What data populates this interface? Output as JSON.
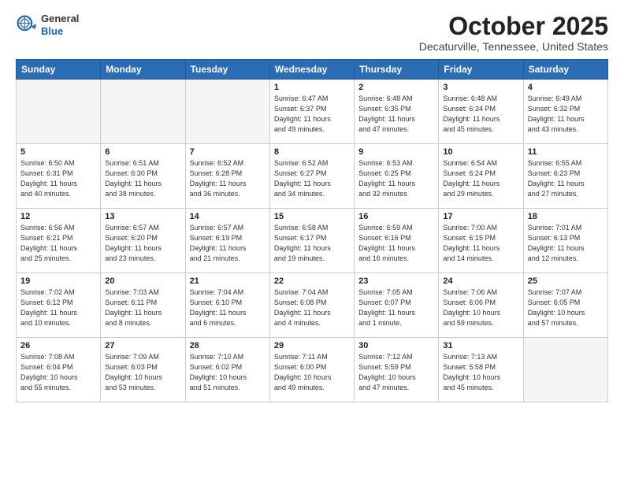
{
  "header": {
    "logo_line1": "General",
    "logo_line2": "Blue",
    "month": "October 2025",
    "location": "Decaturville, Tennessee, United States"
  },
  "weekdays": [
    "Sunday",
    "Monday",
    "Tuesday",
    "Wednesday",
    "Thursday",
    "Friday",
    "Saturday"
  ],
  "weeks": [
    [
      {
        "day": "",
        "info": ""
      },
      {
        "day": "",
        "info": ""
      },
      {
        "day": "",
        "info": ""
      },
      {
        "day": "1",
        "info": "Sunrise: 6:47 AM\nSunset: 6:37 PM\nDaylight: 11 hours\nand 49 minutes."
      },
      {
        "day": "2",
        "info": "Sunrise: 6:48 AM\nSunset: 6:35 PM\nDaylight: 11 hours\nand 47 minutes."
      },
      {
        "day": "3",
        "info": "Sunrise: 6:48 AM\nSunset: 6:34 PM\nDaylight: 11 hours\nand 45 minutes."
      },
      {
        "day": "4",
        "info": "Sunrise: 6:49 AM\nSunset: 6:32 PM\nDaylight: 11 hours\nand 43 minutes."
      }
    ],
    [
      {
        "day": "5",
        "info": "Sunrise: 6:50 AM\nSunset: 6:31 PM\nDaylight: 11 hours\nand 40 minutes."
      },
      {
        "day": "6",
        "info": "Sunrise: 6:51 AM\nSunset: 6:30 PM\nDaylight: 11 hours\nand 38 minutes."
      },
      {
        "day": "7",
        "info": "Sunrise: 6:52 AM\nSunset: 6:28 PM\nDaylight: 11 hours\nand 36 minutes."
      },
      {
        "day": "8",
        "info": "Sunrise: 6:52 AM\nSunset: 6:27 PM\nDaylight: 11 hours\nand 34 minutes."
      },
      {
        "day": "9",
        "info": "Sunrise: 6:53 AM\nSunset: 6:25 PM\nDaylight: 11 hours\nand 32 minutes."
      },
      {
        "day": "10",
        "info": "Sunrise: 6:54 AM\nSunset: 6:24 PM\nDaylight: 11 hours\nand 29 minutes."
      },
      {
        "day": "11",
        "info": "Sunrise: 6:55 AM\nSunset: 6:23 PM\nDaylight: 11 hours\nand 27 minutes."
      }
    ],
    [
      {
        "day": "12",
        "info": "Sunrise: 6:56 AM\nSunset: 6:21 PM\nDaylight: 11 hours\nand 25 minutes."
      },
      {
        "day": "13",
        "info": "Sunrise: 6:57 AM\nSunset: 6:20 PM\nDaylight: 11 hours\nand 23 minutes."
      },
      {
        "day": "14",
        "info": "Sunrise: 6:57 AM\nSunset: 6:19 PM\nDaylight: 11 hours\nand 21 minutes."
      },
      {
        "day": "15",
        "info": "Sunrise: 6:58 AM\nSunset: 6:17 PM\nDaylight: 11 hours\nand 19 minutes."
      },
      {
        "day": "16",
        "info": "Sunrise: 6:59 AM\nSunset: 6:16 PM\nDaylight: 11 hours\nand 16 minutes."
      },
      {
        "day": "17",
        "info": "Sunrise: 7:00 AM\nSunset: 6:15 PM\nDaylight: 11 hours\nand 14 minutes."
      },
      {
        "day": "18",
        "info": "Sunrise: 7:01 AM\nSunset: 6:13 PM\nDaylight: 11 hours\nand 12 minutes."
      }
    ],
    [
      {
        "day": "19",
        "info": "Sunrise: 7:02 AM\nSunset: 6:12 PM\nDaylight: 11 hours\nand 10 minutes."
      },
      {
        "day": "20",
        "info": "Sunrise: 7:03 AM\nSunset: 6:11 PM\nDaylight: 11 hours\nand 8 minutes."
      },
      {
        "day": "21",
        "info": "Sunrise: 7:04 AM\nSunset: 6:10 PM\nDaylight: 11 hours\nand 6 minutes."
      },
      {
        "day": "22",
        "info": "Sunrise: 7:04 AM\nSunset: 6:08 PM\nDaylight: 11 hours\nand 4 minutes."
      },
      {
        "day": "23",
        "info": "Sunrise: 7:05 AM\nSunset: 6:07 PM\nDaylight: 11 hours\nand 1 minute."
      },
      {
        "day": "24",
        "info": "Sunrise: 7:06 AM\nSunset: 6:06 PM\nDaylight: 10 hours\nand 59 minutes."
      },
      {
        "day": "25",
        "info": "Sunrise: 7:07 AM\nSunset: 6:05 PM\nDaylight: 10 hours\nand 57 minutes."
      }
    ],
    [
      {
        "day": "26",
        "info": "Sunrise: 7:08 AM\nSunset: 6:04 PM\nDaylight: 10 hours\nand 55 minutes."
      },
      {
        "day": "27",
        "info": "Sunrise: 7:09 AM\nSunset: 6:03 PM\nDaylight: 10 hours\nand 53 minutes."
      },
      {
        "day": "28",
        "info": "Sunrise: 7:10 AM\nSunset: 6:02 PM\nDaylight: 10 hours\nand 51 minutes."
      },
      {
        "day": "29",
        "info": "Sunrise: 7:11 AM\nSunset: 6:00 PM\nDaylight: 10 hours\nand 49 minutes."
      },
      {
        "day": "30",
        "info": "Sunrise: 7:12 AM\nSunset: 5:59 PM\nDaylight: 10 hours\nand 47 minutes."
      },
      {
        "day": "31",
        "info": "Sunrise: 7:13 AM\nSunset: 5:58 PM\nDaylight: 10 hours\nand 45 minutes."
      },
      {
        "day": "",
        "info": ""
      }
    ]
  ]
}
